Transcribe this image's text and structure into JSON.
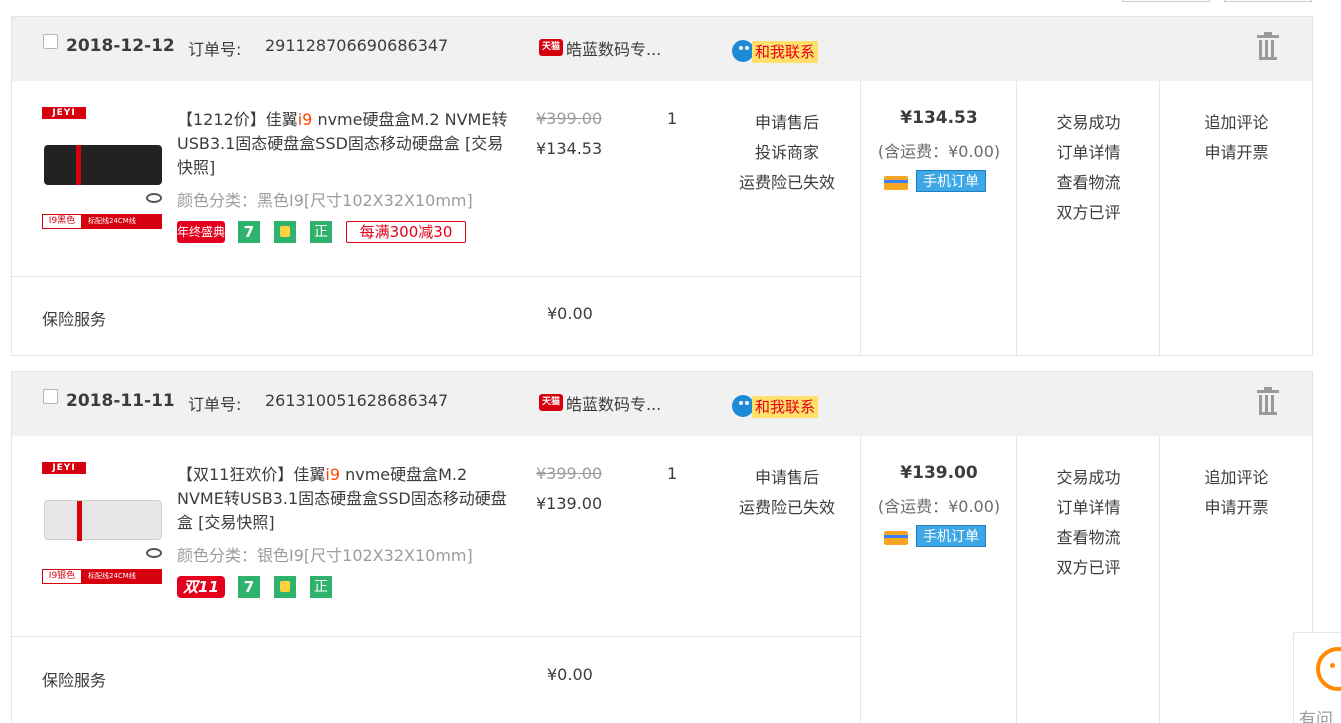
{
  "orders": [
    {
      "date": "2018-12-12",
      "order_no_label": "订单号:",
      "order_no": "291128706690686347",
      "shop_badge": "天猫",
      "shop_name": "皓蓝数码专...",
      "contact_label": "和我联系",
      "item": {
        "thumb_brand": "JEYI",
        "thumb_color": "I9黑色",
        "thumb_cable": "标配线24CM线",
        "title_prefix": "【1212价】佳翼",
        "title_highlight": "i9",
        "title_suffix": " nvme硬盘盒M.2 NVME转USB3.1固态硬盘盒SSD固态移动硬盘盒 [交易快照]",
        "sku": "颜色分类：黑色I9[尺寸102X32X10mm]",
        "badges": [
          "年终盛典",
          "7",
          "",
          "正",
          "每满300减30"
        ],
        "original_price": "¥399.00",
        "price": "¥134.53",
        "qty": "1",
        "after_sale": [
          "申请售后",
          "投诉商家",
          "运费险已失效"
        ]
      },
      "total": "¥134.53",
      "shipping": "(含运费：¥0.00)",
      "mobile_label": "手机订单",
      "status": [
        "交易成功",
        "订单详情",
        "查看物流",
        "双方已评"
      ],
      "ops": [
        "追加评论",
        "申请开票"
      ],
      "insurance_label": "保险服务",
      "insurance_price": "¥0.00"
    },
    {
      "date": "2018-11-11",
      "order_no_label": "订单号:",
      "order_no": "261310051628686347",
      "shop_badge": "天猫",
      "shop_name": "皓蓝数码专...",
      "contact_label": "和我联系",
      "item": {
        "thumb_brand": "JEYI",
        "thumb_color": "I9银色",
        "thumb_cable": "标配线24CM线",
        "title_prefix": "【双11狂欢价】佳翼",
        "title_highlight": "i9",
        "title_suffix": " nvme硬盘盒M.2 NVME转USB3.1固态硬盘盒SSD固态移动硬盘盒 [交易快照]",
        "sku": "颜色分类：银色I9[尺寸102X32X10mm]",
        "badges": [
          "双11",
          "7",
          "",
          "正"
        ],
        "original_price": "¥399.00",
        "price": "¥139.00",
        "qty": "1",
        "after_sale": [
          "申请售后",
          "运费险已失效"
        ]
      },
      "total": "¥139.00",
      "shipping": "(含运费：¥0.00)",
      "mobile_label": "手机订单",
      "status": [
        "交易成功",
        "订单详情",
        "查看物流",
        "双方已评"
      ],
      "ops": [
        "追加评论",
        "申请开票"
      ],
      "insurance_label": "保险服务",
      "insurance_price": "¥0.00"
    }
  ],
  "helper_label": "有问",
  "colors": {
    "accent": "#f40",
    "tmall_red": "#d6000f",
    "header_bg": "#f1f1f1",
    "link_blue": "#3ea7e6"
  }
}
